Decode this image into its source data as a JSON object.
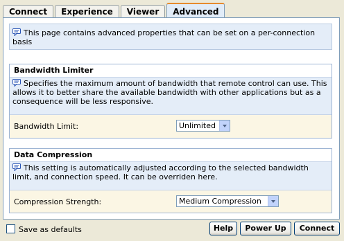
{
  "tabs": [
    {
      "label": "Connect"
    },
    {
      "label": "Experience"
    },
    {
      "label": "Viewer"
    },
    {
      "label": "Advanced"
    }
  ],
  "active_tab": "Advanced",
  "info": {
    "text": "This page contains advanced properties that can be set on a per-connection basis"
  },
  "bandwidth": {
    "title": "Bandwidth Limiter",
    "description": "Specifies the maximum amount of bandwidth that remote control can use. This allows it to better share the available bandwidth with other applications but as a consequence will be less responsive.",
    "field_label": "Bandwidth Limit:",
    "selected": "Unlimited"
  },
  "compression": {
    "title": "Data Compression",
    "description": "This setting is automatically adjusted according to the selected bandwidth limit, and connection speed. It can be overriden here.",
    "field_label": "Compression Strength:",
    "selected": "Medium Compression"
  },
  "footer": {
    "save_defaults_label": "Save as defaults",
    "save_defaults_checked": false,
    "help_label": "Help",
    "powerup_label": "Power Up",
    "connect_label": "Connect"
  },
  "colors": {
    "accent_tab_top": "#e68b2c",
    "info_bg": "#e4edf8",
    "group_bg": "#fbf6e4"
  }
}
